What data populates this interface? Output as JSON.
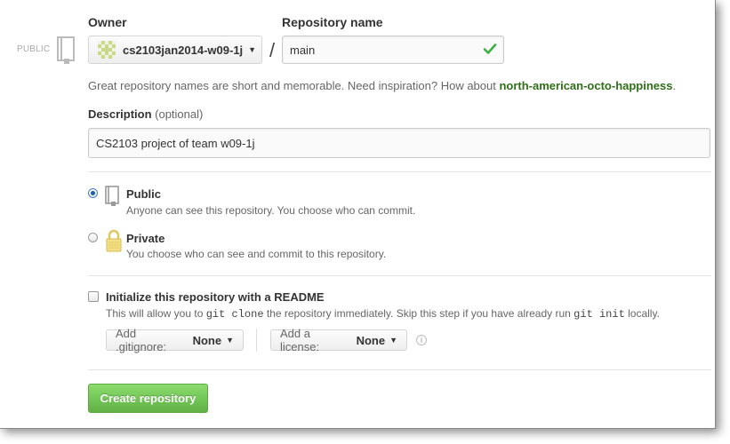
{
  "owner": {
    "label": "Owner",
    "value": "cs2103jan2014-w09-1j"
  },
  "repository": {
    "label": "Repository name",
    "value": "main"
  },
  "visibility_tag": "PUBLIC",
  "separator": "/",
  "hint": {
    "text": "Great repository names are short and memorable. Need inspiration? How about ",
    "suggestion": "north-american-octo-happiness",
    "end": "."
  },
  "description": {
    "label": "Description",
    "optional": "(optional)",
    "value": "CS2103 project of team w09-1j"
  },
  "visibility": [
    {
      "title": "Public",
      "desc": "Anyone can see this repository. You choose who can commit.",
      "selected": true
    },
    {
      "title": "Private",
      "desc": "You choose who can see and commit to this repository.",
      "selected": false
    }
  ],
  "readme": {
    "label": "Initialize this repository with a README",
    "desc_1": "This will allow you to",
    "code_1": "git clone",
    "desc_2": "the repository immediately. Skip this step if you have already run",
    "code_2": "git init",
    "desc_3": "locally."
  },
  "gitignore": {
    "label": "Add .gitignore:",
    "value": "None"
  },
  "license": {
    "label": "Add a license:",
    "value": "None"
  },
  "info_glyph": "i",
  "submit_label": "Create repository",
  "colors": {
    "accent_green": "#60b044",
    "check_green": "#3cb043",
    "suggestion_green": "#2f6f18"
  }
}
